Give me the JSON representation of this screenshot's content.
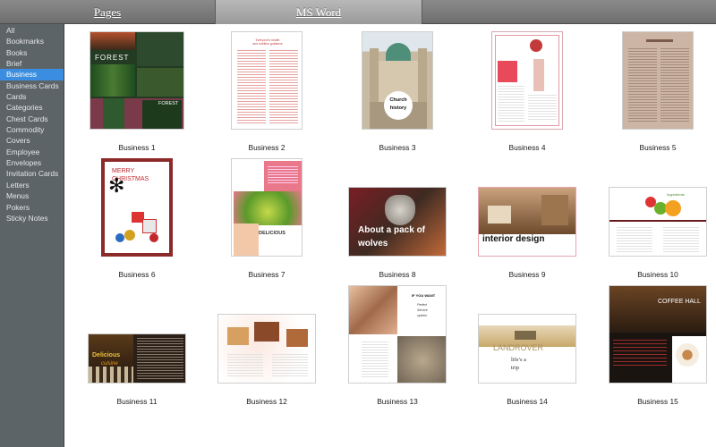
{
  "tabs": {
    "pages": "Pages",
    "msword": "MS Word"
  },
  "sidebar": {
    "items": [
      {
        "label": "All"
      },
      {
        "label": "Bookmarks"
      },
      {
        "label": "Books"
      },
      {
        "label": "Brief"
      },
      {
        "label": "Business",
        "active": true
      },
      {
        "label": "Business Cards"
      },
      {
        "label": "Cards"
      },
      {
        "label": "Categories"
      },
      {
        "label": "Chest Cards"
      },
      {
        "label": "Commodity"
      },
      {
        "label": "Covers"
      },
      {
        "label": "Employee"
      },
      {
        "label": "Envelopes"
      },
      {
        "label": "Invitation Cards"
      },
      {
        "label": "Letters"
      },
      {
        "label": "Menus"
      },
      {
        "label": "Pokers"
      },
      {
        "label": "Sticky Notes"
      }
    ]
  },
  "templates": [
    {
      "name": "Business 1",
      "title": "FOREST",
      "subtitle": "FOREST"
    },
    {
      "name": "Business 2",
      "title": "Everyone's health\nand nutrition guidance"
    },
    {
      "name": "Business 3",
      "title": "Church\nhistory"
    },
    {
      "name": "Business 4"
    },
    {
      "name": "Business 5"
    },
    {
      "name": "Business 6",
      "title": "MERRY\nCHRISTMAS"
    },
    {
      "name": "Business 7",
      "title": "DELICIOUS"
    },
    {
      "name": "Business 8",
      "title": "About a pack of\nwolves"
    },
    {
      "name": "Business 9",
      "title": "interior design"
    },
    {
      "name": "Business 10",
      "title": "Ingredients"
    },
    {
      "name": "Business 11",
      "title": "Delicious",
      "subtitle": "cuisine"
    },
    {
      "name": "Business 12"
    },
    {
      "name": "Business 13",
      "title": "IF YOU WANT",
      "subtitle": "Perfect\nService\nsystem"
    },
    {
      "name": "Business 14",
      "title": "LANDROVER",
      "subtitle": "life's a\ntrip"
    },
    {
      "name": "Business 15",
      "title": "COFFEE HALL"
    }
  ],
  "colors": {
    "accent": "#3a8de0",
    "sidebar_bg": "#5d6468",
    "topbar": "#7a7a7a"
  }
}
